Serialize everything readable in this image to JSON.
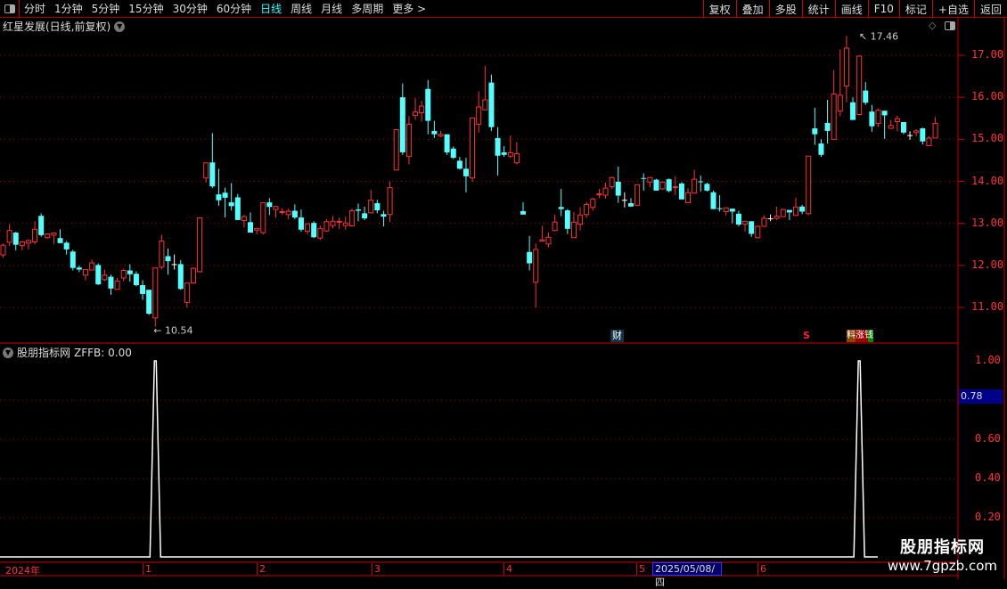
{
  "toolbar": {
    "periods": [
      "分时",
      "1分钟",
      "5分钟",
      "15分钟",
      "30分钟",
      "60分钟",
      "日线",
      "周线",
      "月线",
      "多周期",
      "更多 >"
    ],
    "active_period": "日线",
    "buttons": [
      "复权",
      "叠加",
      "多股",
      "统计",
      "画线",
      "F10",
      "标记",
      "+自选",
      "返回"
    ]
  },
  "main": {
    "title": "红星发展(日线,前复权)",
    "high_label": "17.46",
    "low_label": "10.54",
    "y_ticks": [
      "17.00",
      "16.00",
      "15.00",
      "14.00",
      "13.00",
      "12.00",
      "11.00"
    ],
    "markers": {
      "finance": "财",
      "s": "S",
      "tags": "料涨钱"
    }
  },
  "indicator": {
    "title": "股朋指标网",
    "formula": "ZFFB: 0.00",
    "y_ticks": [
      "1.00",
      "0.60",
      "0.40",
      "0.20"
    ],
    "cursor_value": "0.78"
  },
  "x_axis": {
    "labels": [
      "2024年",
      "1",
      "2",
      "3",
      "4",
      "5",
      "6"
    ],
    "cursor_date": "2025/05/08/四"
  },
  "watermark": {
    "name": "股朋指标网",
    "url": "www.7gpzb.com"
  },
  "colors": {
    "up": "#ff3232",
    "down": "#54ffff",
    "doji": "#ffffff",
    "grid": "#a00000",
    "active": "#33ffff"
  },
  "chart_data": [
    {
      "type": "candlestick",
      "ylim": [
        10.4,
        17.6
      ],
      "y_ticks": [
        11,
        12,
        13,
        14,
        15,
        16,
        17
      ],
      "candles_ohlc": [
        [
          12.25,
          12.52,
          12.18,
          12.48
        ],
        [
          12.55,
          12.98,
          12.46,
          12.83
        ],
        [
          12.78,
          12.8,
          12.36,
          12.49
        ],
        [
          12.47,
          12.58,
          12.36,
          12.56
        ],
        [
          12.53,
          12.62,
          12.38,
          12.59
        ],
        [
          12.56,
          13.05,
          12.5,
          12.86
        ],
        [
          13.18,
          13.24,
          12.68,
          12.72
        ],
        [
          12.66,
          12.75,
          12.64,
          12.75
        ],
        [
          12.72,
          12.77,
          12.5,
          12.77
        ],
        [
          12.65,
          12.86,
          12.53,
          12.53
        ],
        [
          12.54,
          12.58,
          12.26,
          12.38
        ],
        [
          12.33,
          12.37,
          11.88,
          11.94
        ],
        [
          11.95,
          12.0,
          11.84,
          11.9
        ],
        [
          11.77,
          11.9,
          11.64,
          11.9
        ],
        [
          11.89,
          12.14,
          11.88,
          12.06
        ],
        [
          12.01,
          12.05,
          11.53,
          11.55
        ],
        [
          11.66,
          11.9,
          11.63,
          11.77
        ],
        [
          11.73,
          11.78,
          11.3,
          11.45
        ],
        [
          11.43,
          11.7,
          11.43,
          11.63
        ],
        [
          11.7,
          11.92,
          11.62,
          11.88
        ],
        [
          11.88,
          12.03,
          11.61,
          11.79
        ],
        [
          11.8,
          11.86,
          11.5,
          11.53
        ],
        [
          11.53,
          11.65,
          11.18,
          11.32
        ],
        [
          11.42,
          11.42,
          10.82,
          10.85
        ],
        [
          10.75,
          11.94,
          10.54,
          11.94
        ],
        [
          11.96,
          12.73,
          11.91,
          12.58
        ],
        [
          12.22,
          12.4,
          11.78,
          12.1
        ],
        [
          12.03,
          12.26,
          11.9,
          12.03
        ],
        [
          12.03,
          12.13,
          11.42,
          11.44
        ],
        [
          11.12,
          11.58,
          11.0,
          11.58
        ],
        [
          11.58,
          11.95,
          11.56,
          11.93
        ],
        [
          11.85,
          13.13,
          11.83,
          13.13
        ],
        [
          14.08,
          14.44,
          13.97,
          14.44
        ],
        [
          14.45,
          15.15,
          13.84,
          13.88
        ],
        [
          13.69,
          14.3,
          13.42,
          13.55
        ],
        [
          13.73,
          13.85,
          13.14,
          13.61
        ],
        [
          13.5,
          13.96,
          13.31,
          13.41
        ],
        [
          13.62,
          13.7,
          13.08,
          13.08
        ],
        [
          13.07,
          13.2,
          12.9,
          13.16
        ],
        [
          13.03,
          13.26,
          12.78,
          12.78
        ],
        [
          12.84,
          12.89,
          12.74,
          12.88
        ],
        [
          12.78,
          13.5,
          12.74,
          13.49
        ],
        [
          13.5,
          13.6,
          13.2,
          13.39
        ],
        [
          13.33,
          13.42,
          13.13,
          13.4
        ],
        [
          13.26,
          13.36,
          13.2,
          13.28
        ],
        [
          13.21,
          13.35,
          13.1,
          13.29
        ],
        [
          13.3,
          13.45,
          13.1,
          13.14
        ],
        [
          13.14,
          13.33,
          12.8,
          12.85
        ],
        [
          12.81,
          12.99,
          12.74,
          12.99
        ],
        [
          13.01,
          13.05,
          12.65,
          12.67
        ],
        [
          12.65,
          12.95,
          12.6,
          12.88
        ],
        [
          12.82,
          13.1,
          12.8,
          13.04
        ],
        [
          12.95,
          13.18,
          12.88,
          13.05
        ],
        [
          13.03,
          13.14,
          12.87,
          13.05
        ],
        [
          12.95,
          13.16,
          12.85,
          13.01
        ],
        [
          12.94,
          13.35,
          12.93,
          13.3
        ],
        [
          13.33,
          13.47,
          13.05,
          13.3
        ],
        [
          13.24,
          13.4,
          13.08,
          13.12
        ],
        [
          13.25,
          13.8,
          13.24,
          13.55
        ],
        [
          13.48,
          13.56,
          13.24,
          13.31
        ],
        [
          13.22,
          13.3,
          12.93,
          13.16
        ],
        [
          13.21,
          14.0,
          13.03,
          13.85
        ],
        [
          14.27,
          15.23,
          14.27,
          15.23
        ],
        [
          16.0,
          16.33,
          14.63,
          14.69
        ],
        [
          14.59,
          15.55,
          14.4,
          15.36
        ],
        [
          15.57,
          15.98,
          15.46,
          15.65
        ],
        [
          15.63,
          15.92,
          15.42,
          15.79
        ],
        [
          16.2,
          16.41,
          15.12,
          15.44
        ],
        [
          15.2,
          15.44,
          15.03,
          15.12
        ],
        [
          15.08,
          15.2,
          15.05,
          15.12
        ],
        [
          15.12,
          15.12,
          14.63,
          14.69
        ],
        [
          14.78,
          14.83,
          14.53,
          14.56
        ],
        [
          14.49,
          14.58,
          14.28,
          14.3
        ],
        [
          14.3,
          14.56,
          13.74,
          14.12
        ],
        [
          14.08,
          15.51,
          13.99,
          15.51
        ],
        [
          15.36,
          16.14,
          15.16,
          15.77
        ],
        [
          15.7,
          16.75,
          15.7,
          15.94
        ],
        [
          16.35,
          16.54,
          15.2,
          15.29
        ],
        [
          15.03,
          15.29,
          14.14,
          14.61
        ],
        [
          14.69,
          14.84,
          14.58,
          14.63
        ],
        [
          14.6,
          15.09,
          14.55,
          14.68
        ],
        [
          14.44,
          14.94,
          14.4,
          14.66
        ],
        [
          13.29,
          13.5,
          13.21,
          13.21
        ],
        [
          12.32,
          12.7,
          11.88,
          12.05
        ],
        [
          11.6,
          12.52,
          11.0,
          12.38
        ],
        [
          12.58,
          12.94,
          12.58,
          12.61
        ],
        [
          12.51,
          12.78,
          12.43,
          12.67
        ],
        [
          12.83,
          13.21,
          12.81,
          13.03
        ],
        [
          13.39,
          13.82,
          13.17,
          13.34
        ],
        [
          13.31,
          13.34,
          12.75,
          12.87
        ],
        [
          12.66,
          13.27,
          12.66,
          13.03
        ],
        [
          12.98,
          13.38,
          12.83,
          13.2
        ],
        [
          13.21,
          13.5,
          13.13,
          13.45
        ],
        [
          13.38,
          13.61,
          13.3,
          13.58
        ],
        [
          13.68,
          13.82,
          13.6,
          13.7
        ],
        [
          13.67,
          13.97,
          13.59,
          13.84
        ],
        [
          13.87,
          14.11,
          13.82,
          14.09
        ],
        [
          13.99,
          14.35,
          13.49,
          13.66
        ],
        [
          13.56,
          13.74,
          13.38,
          13.56
        ],
        [
          13.48,
          13.6,
          13.4,
          13.4
        ],
        [
          13.43,
          13.92,
          13.42,
          13.92
        ],
        [
          14.08,
          14.19,
          13.78,
          14.07
        ],
        [
          13.98,
          14.09,
          13.86,
          14.09
        ],
        [
          14.04,
          14.06,
          13.78,
          13.78
        ],
        [
          13.82,
          14.0,
          13.8,
          13.98
        ],
        [
          14.05,
          14.07,
          13.74,
          13.77
        ],
        [
          13.86,
          14.12,
          13.67,
          13.87
        ],
        [
          13.95,
          13.98,
          13.57,
          13.57
        ],
        [
          13.49,
          13.84,
          13.48,
          13.73
        ],
        [
          13.72,
          14.27,
          13.72,
          14.05
        ],
        [
          14.0,
          14.14,
          13.76,
          13.98
        ],
        [
          13.94,
          13.97,
          13.76,
          13.78
        ],
        [
          13.74,
          13.78,
          13.34,
          13.34
        ],
        [
          13.36,
          13.67,
          13.28,
          13.35
        ],
        [
          13.28,
          13.37,
          13.19,
          13.37
        ],
        [
          13.35,
          13.35,
          13.0,
          13.28
        ],
        [
          13.23,
          13.3,
          12.93,
          12.97
        ],
        [
          12.98,
          13.05,
          12.8,
          13.05
        ],
        [
          13.05,
          13.05,
          12.68,
          12.75
        ],
        [
          12.66,
          12.95,
          12.64,
          12.93
        ],
        [
          12.93,
          13.19,
          12.92,
          13.12
        ],
        [
          13.12,
          13.21,
          13.05,
          13.12
        ],
        [
          13.12,
          13.4,
          13.08,
          13.17
        ],
        [
          13.16,
          13.35,
          13.15,
          13.33
        ],
        [
          13.32,
          13.32,
          13.08,
          13.26
        ],
        [
          13.19,
          13.61,
          13.17,
          13.39
        ],
        [
          13.4,
          13.44,
          13.22,
          13.28
        ],
        [
          13.23,
          14.6,
          13.2,
          14.6
        ],
        [
          15.26,
          15.75,
          14.87,
          15.12
        ],
        [
          14.9,
          15.0,
          14.58,
          14.63
        ],
        [
          15.39,
          15.94,
          14.9,
          15.2
        ],
        [
          15.0,
          16.65,
          15.0,
          16.08
        ],
        [
          15.67,
          17.14,
          15.55,
          16.05
        ],
        [
          16.27,
          17.46,
          15.88,
          17.17
        ],
        [
          15.88,
          16.0,
          15.46,
          15.46
        ],
        [
          15.59,
          16.98,
          15.59,
          16.98
        ],
        [
          16.16,
          16.36,
          15.82,
          15.87
        ],
        [
          15.66,
          15.82,
          15.18,
          15.31
        ],
        [
          15.38,
          15.73,
          15.3,
          15.69
        ],
        [
          15.68,
          15.68,
          15.01,
          15.57
        ],
        [
          15.26,
          15.46,
          15.25,
          15.33
        ],
        [
          15.42,
          15.56,
          15.19,
          15.49
        ],
        [
          15.41,
          15.41,
          15.12,
          15.16
        ],
        [
          15.1,
          15.19,
          14.99,
          15.1
        ],
        [
          15.16,
          15.24,
          15.07,
          15.2
        ],
        [
          15.26,
          15.28,
          14.88,
          14.95
        ],
        [
          14.85,
          15.07,
          14.85,
          15.03
        ],
        [
          15.03,
          15.53,
          15.03,
          15.38
        ]
      ]
    },
    {
      "type": "line",
      "name": "ZFFB",
      "ylim": [
        0,
        1.05
      ],
      "spikes_at_candle": [
        25,
        136
      ],
      "spike_value": 1.0,
      "baseline": 0
    }
  ]
}
